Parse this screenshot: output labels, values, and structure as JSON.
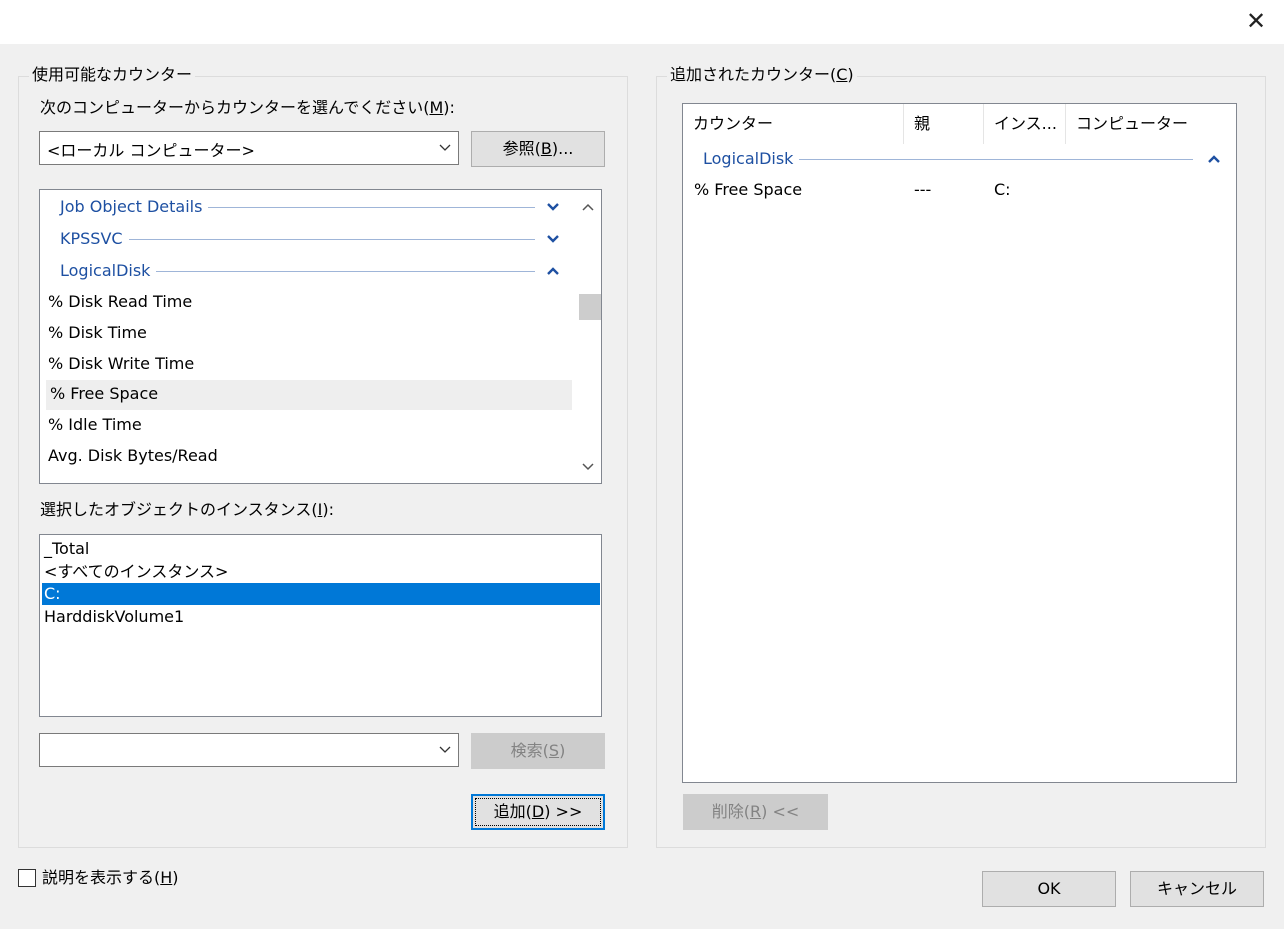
{
  "window": {
    "close_glyph": "✕"
  },
  "available": {
    "group_title": "使用可能なカウンター",
    "computer_label": "次のコンピューターからカウンターを選んでください(",
    "computer_label_key": "M",
    "computer_label_end": "):",
    "computer_value": "<ローカル コンピューター>",
    "browse_label": "参照(",
    "browse_key": "B",
    "browse_end": ")...",
    "counter_groups": [
      {
        "name": "Job Object Details",
        "state": "collapsed"
      },
      {
        "name": "KPSSVC",
        "state": "collapsed"
      },
      {
        "name": "LogicalDisk",
        "state": "expanded"
      }
    ],
    "counters": [
      "% Disk Read Time",
      "% Disk Time",
      "% Disk Write Time",
      "% Free Space",
      "% Idle Time",
      "Avg. Disk Bytes/Read"
    ],
    "hovered_counter": "% Free Space",
    "instances_label": "選択したオブジェクトのインスタンス(",
    "instances_key": "I",
    "instances_end": "):",
    "instances": [
      "_Total",
      "<すべてのインスタンス>",
      "C:",
      "HarddiskVolume1"
    ],
    "selected_instance": "C:",
    "search_value": "",
    "search_label": "検索(",
    "search_key": "S",
    "search_end": ")",
    "add_label": "追加(",
    "add_key": "D",
    "add_end": ") >>"
  },
  "added": {
    "group_title": "追加されたカウンター(",
    "group_key": "C",
    "group_end": ")",
    "columns": [
      "カウンター",
      "親",
      "インス...",
      "コンピューター"
    ],
    "group_name": "LogicalDisk",
    "rows": [
      {
        "counter": "% Free Space",
        "parent": "---",
        "instance": "C:",
        "computer": ""
      }
    ],
    "remove_label": "削除(",
    "remove_key": "R",
    "remove_end": ") <<"
  },
  "footer": {
    "show_desc_label": "説明を表示する(",
    "show_desc_key": "H",
    "show_desc_end": ")",
    "show_desc_checked": false,
    "ok_label": "OK",
    "cancel_label": "キャンセル"
  },
  "colors": {
    "accent": "#0078d7",
    "group_link": "#1e50a2"
  }
}
